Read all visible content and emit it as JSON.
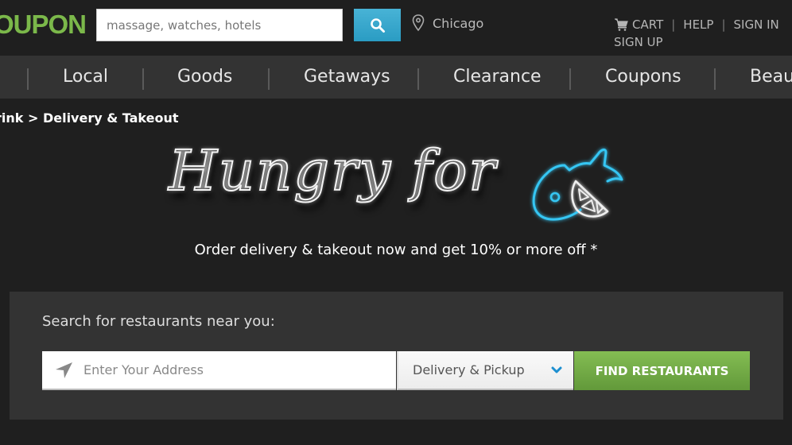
{
  "header": {
    "logo_text": "OUPON",
    "search": {
      "placeholder": "massage, watches, hotels",
      "value": ""
    },
    "search_button_icon": "search-icon",
    "location": {
      "icon": "map-pin-icon",
      "city": "Chicago"
    },
    "links": {
      "cart": "CART",
      "help": "HELP",
      "sign_in": "SIGN IN",
      "sign_up": "SIGN UP",
      "separator": "|"
    }
  },
  "nav": {
    "items": [
      {
        "label": "Local"
      },
      {
        "label": "Goods"
      },
      {
        "label": "Getaways"
      },
      {
        "label": "Clearance"
      },
      {
        "label": "Coupons"
      },
      {
        "label": "Beaut"
      }
    ]
  },
  "breadcrumb": "rink > Delivery & Takeout",
  "hero": {
    "title": "Hungry for",
    "icon": "fish-with-lemon-neon-icon",
    "tagline": "Order delivery & takeout now and get 10% or more off *"
  },
  "search_panel": {
    "label": "Search for restaurants near you:",
    "address": {
      "placeholder": "Enter Your Address",
      "value": "",
      "icon": "location-arrow-icon"
    },
    "mode": {
      "selected": "Delivery & Pickup",
      "icon": "chevron-down-icon"
    },
    "submit_label": "FIND RESTAURANTS"
  },
  "colors": {
    "brand_green": "#7bb84a",
    "search_blue": "#2a9cc3",
    "button_green": "#6fa843",
    "neon_blue": "#2fc3f0",
    "background": "#1f1f1f",
    "panel": "#333333"
  }
}
